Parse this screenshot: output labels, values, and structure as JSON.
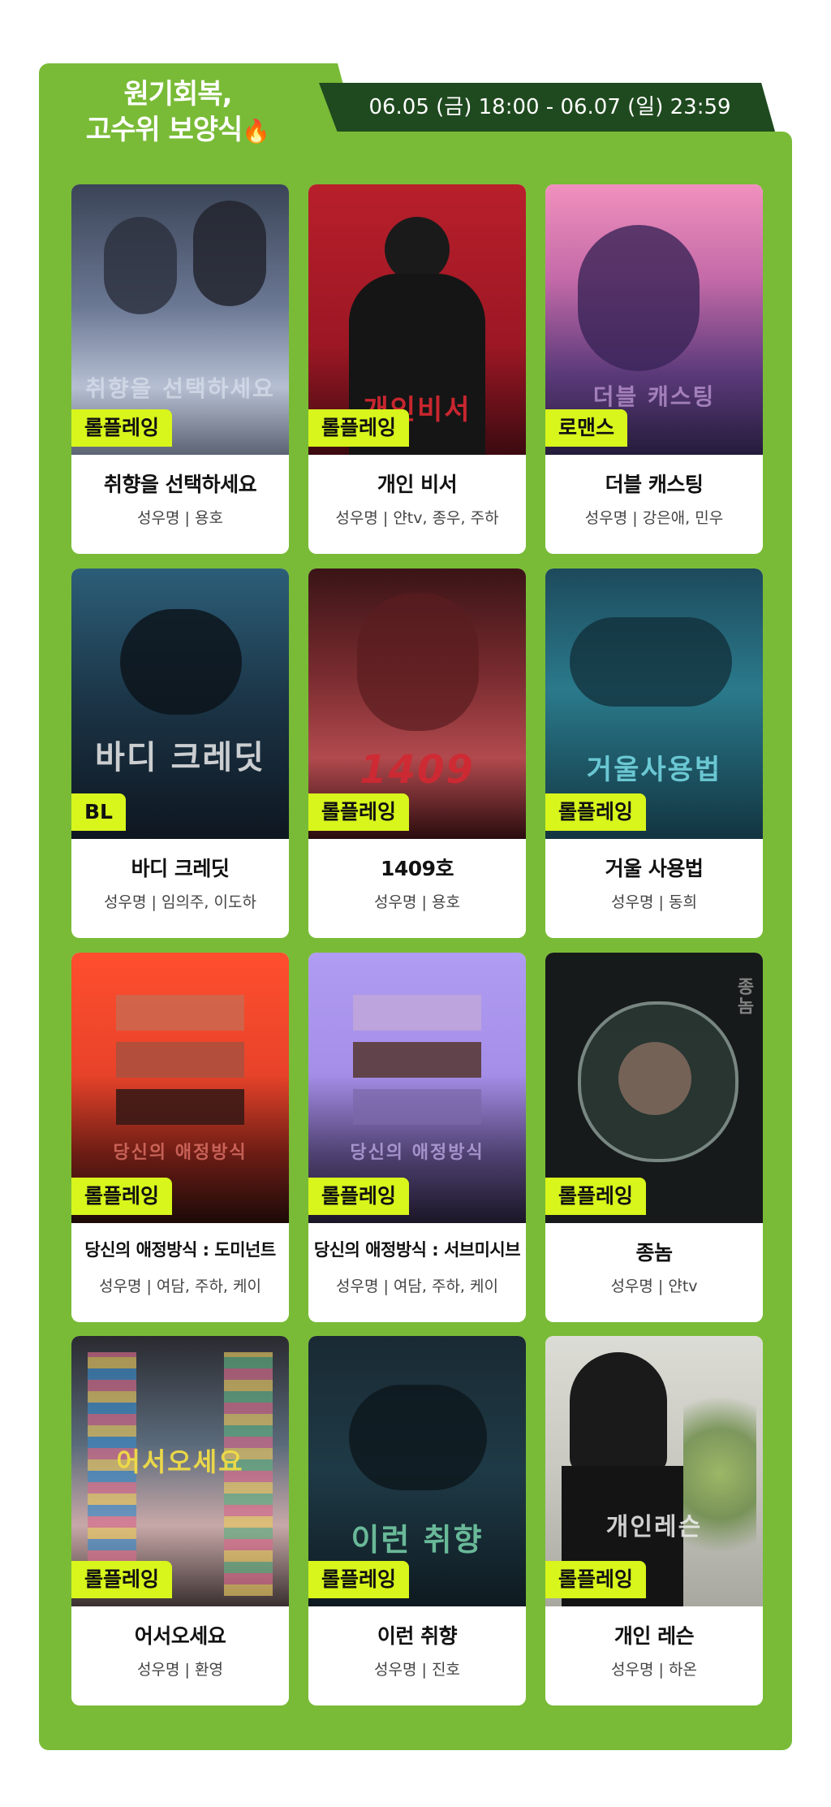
{
  "header": {
    "title_line1": "원기회복,",
    "title_line2": "고수위 보양식",
    "fire_emoji": "🔥",
    "date_range": "06.05 (금) 18:00 - 06.07 (일) 23:59"
  },
  "colors": {
    "panel_green": "#79bb37",
    "date_bar": "#1f4a1f",
    "badge": "#d8f51c"
  },
  "cards": [
    {
      "genre": "롤플레잉",
      "title": "취향을 선택하세요",
      "voice": "성우명 | 용호",
      "poster_text": "취향을 선택하세요"
    },
    {
      "genre": "롤플레잉",
      "title": "개인 비서",
      "voice": "성우명 | 얀tv, 종우, 주하",
      "poster_text": "개인비서"
    },
    {
      "genre": "로맨스",
      "title": "더블 캐스팅",
      "voice": "성우명 | 강은애, 민우",
      "poster_text": "더블 캐스팅"
    },
    {
      "genre": "BL",
      "title": "바디 크레딧",
      "voice": "성우명 | 임의주, 이도하",
      "poster_text": "바디 크레딧"
    },
    {
      "genre": "롤플레잉",
      "title": "1409호",
      "voice": "성우명 | 용호",
      "poster_text": "1409"
    },
    {
      "genre": "롤플레잉",
      "title": "거울 사용법",
      "voice": "성우명 | 동희",
      "poster_text": "거울사용법"
    },
    {
      "genre": "롤플레잉",
      "title": "당신의 애정방식 : 도미넌트",
      "voice": "성우명 | 여담, 주하, 케이",
      "poster_text": "당신의 애정방식"
    },
    {
      "genre": "롤플레잉",
      "title": "당신의 애정방식 : 서브미시브",
      "voice": "성우명 | 여담, 주하, 케이",
      "poster_text": "당신의 애정방식"
    },
    {
      "genre": "롤플레잉",
      "title": "종놈",
      "voice": "성우명 | 얀tv",
      "poster_text": "종놈"
    },
    {
      "genre": "롤플레잉",
      "title": "어서오세요",
      "voice": "성우명 | 환영",
      "poster_text": "어서오세요"
    },
    {
      "genre": "롤플레잉",
      "title": "이런 취향",
      "voice": "성우명 | 진호",
      "poster_text": "이런 취향"
    },
    {
      "genre": "롤플레잉",
      "title": "개인 레슨",
      "voice": "성우명 | 하온",
      "poster_text": "개인레슨"
    }
  ]
}
